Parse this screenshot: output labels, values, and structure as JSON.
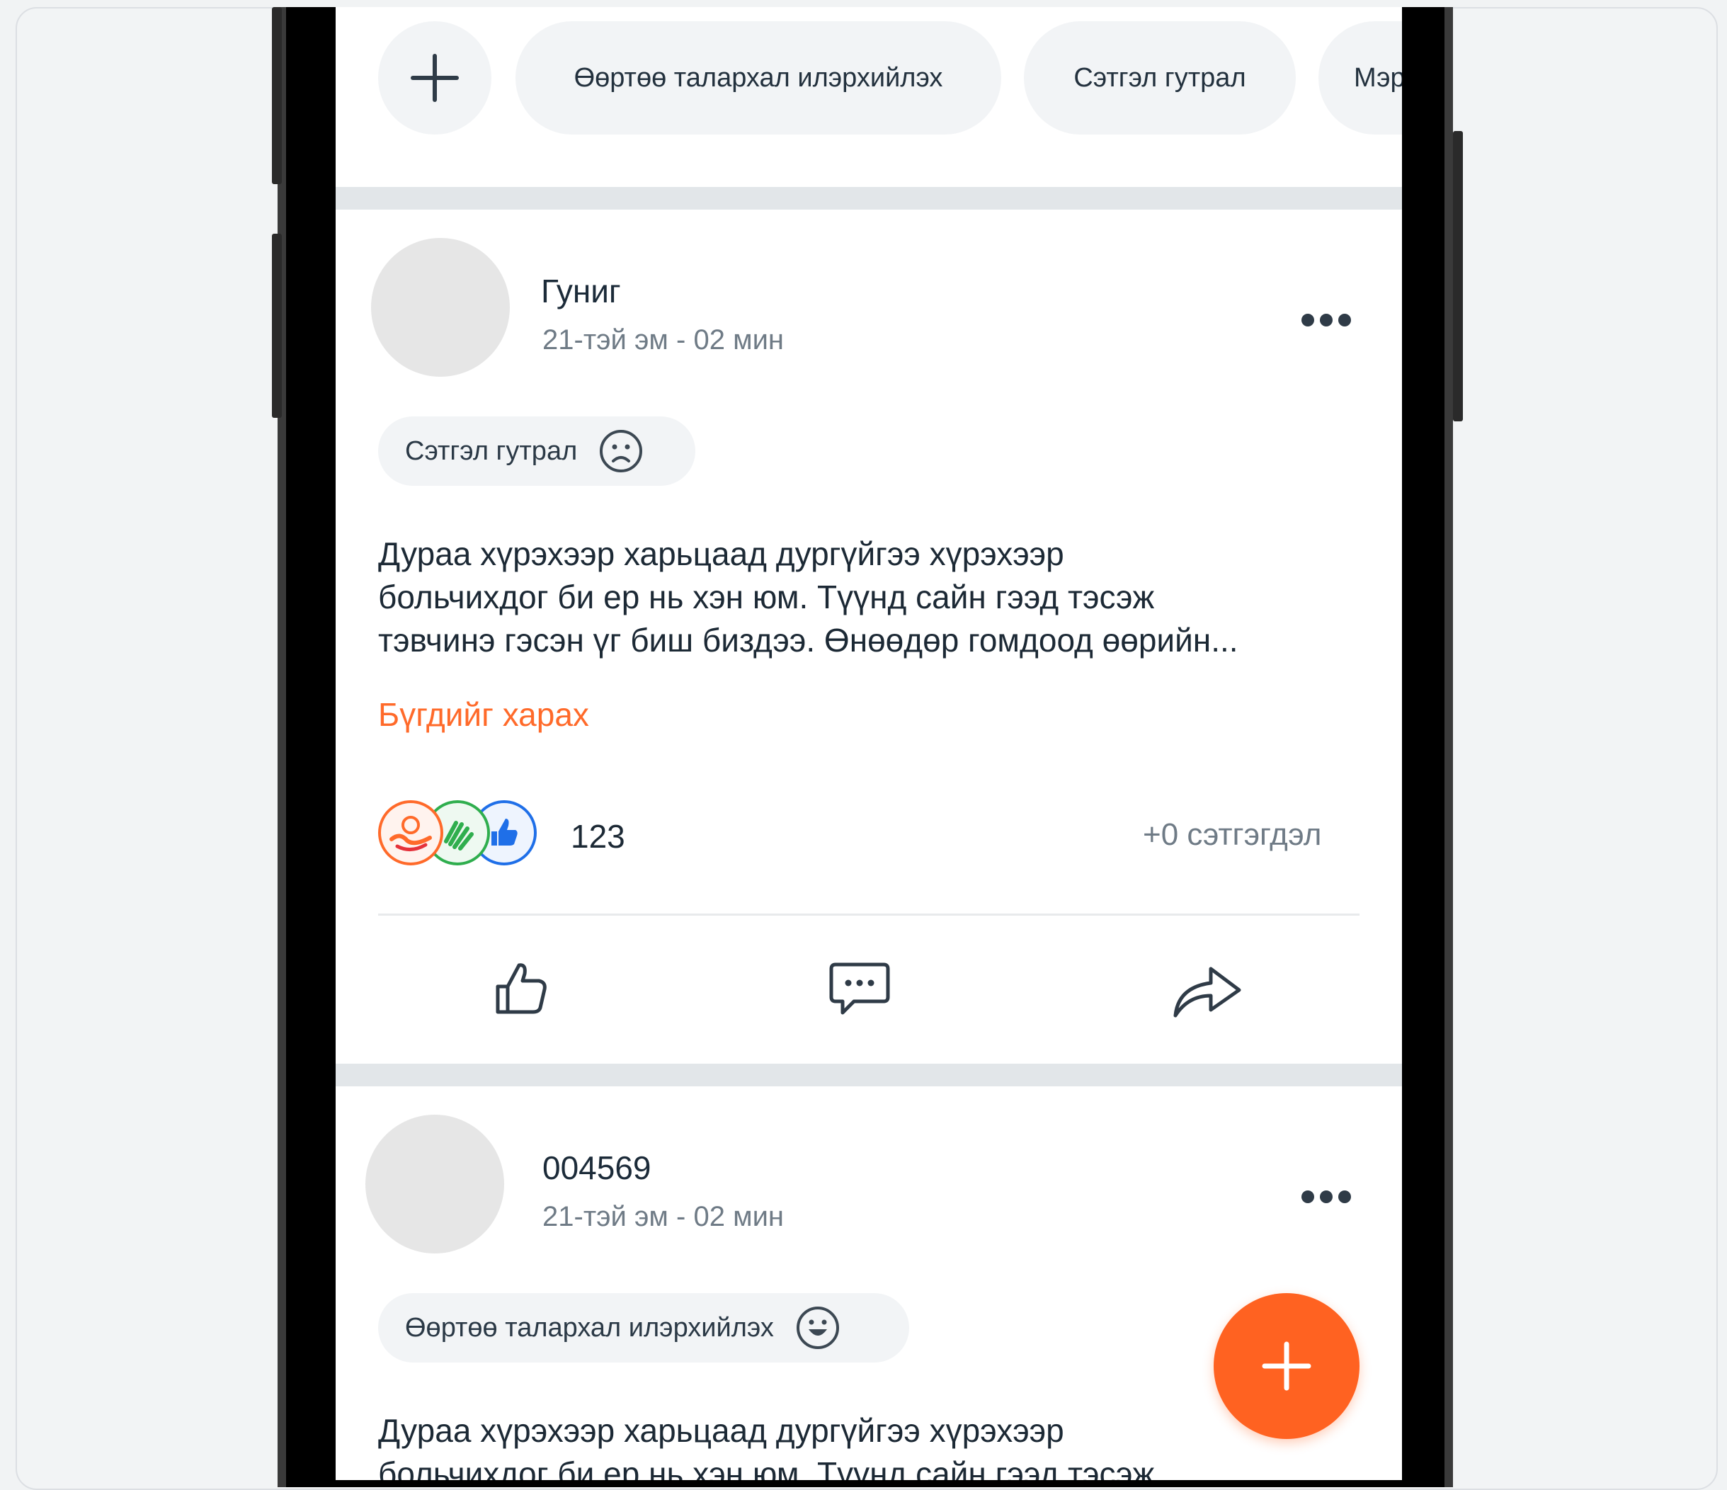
{
  "chips": {
    "items": [
      {
        "label": "Өөртөө талархал илэрхийлэх"
      },
      {
        "label": "Сэтгэл гутрал"
      },
      {
        "label": "Мэр"
      }
    ]
  },
  "posts": [
    {
      "author": "Гуниг",
      "time": "21-тэй эм - 02 мин",
      "tag": "Сэтгэл гутрал",
      "text": "Дураа хүрэхээр харьцаад дургүйгээ хүрэхээр\nбольчихдог би ер нь хэн юм. Түүнд сайн гээд тэсэж\nтэвчинэ гэсэн үг биш биздээ. Өнөөдөр гомдоод өөрийн...",
      "see_all": "Бүгдийг харах",
      "reaction_count": "123",
      "comments": "+0 сэтгэгдэл"
    },
    {
      "author": "004569",
      "time": "21-тэй эм - 02 мин",
      "tag": "Өөртөө талархал илэрхийлэх",
      "text": "Дураа хүрэхээр харьцаад дургүйгээ хүрэхээр\nбольчихдог би ер нь хэн юм. Түүнд сайн гээд тэсэж"
    }
  ],
  "colors": {
    "accent": "#ff6221",
    "see_all": "#ff6a2a",
    "reaction_love": "#ff6a2a",
    "reaction_clap": "#2fae4e",
    "reaction_like": "#1f6fe8"
  },
  "icons": [
    "plus-icon",
    "sad-face-icon",
    "happy-face-icon",
    "more-dots-icon",
    "thumbs-up-icon",
    "comment-icon",
    "share-icon",
    "love-reaction-icon",
    "clap-reaction-icon",
    "like-reaction-icon"
  ]
}
